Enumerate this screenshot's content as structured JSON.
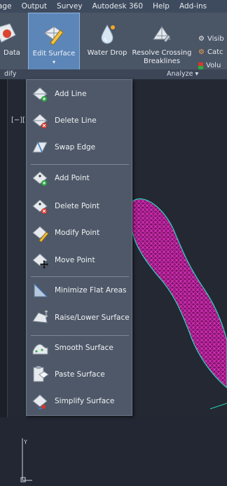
{
  "menubar": {
    "items": [
      "age",
      "Output",
      "Survey",
      "Autodesk 360",
      "Help",
      "Add-ins"
    ]
  },
  "ribbon": {
    "data_label": "Data",
    "edit_surface_label": "Edit Surface",
    "water_drop_label": "Water Drop",
    "resolve_line1": "Resolve Crossing",
    "resolve_line2": "Breaklines",
    "small": [
      "Visib",
      "Catc",
      "Volu"
    ],
    "panel_left": "dify",
    "panel_analyze": "Analyze ▾"
  },
  "viewport": {
    "label": "[−]["
  },
  "dropdown": {
    "items": [
      {
        "label": "Add Line",
        "icon": "add-line-icon"
      },
      {
        "label": "Delete Line",
        "icon": "delete-line-icon"
      },
      {
        "label": "Swap Edge",
        "icon": "swap-edge-icon"
      },
      {
        "label": "Add Point",
        "icon": "add-point-icon"
      },
      {
        "label": "Delete Point",
        "icon": "delete-point-icon"
      },
      {
        "label": "Modify Point",
        "icon": "modify-point-icon"
      },
      {
        "label": "Move Point",
        "icon": "move-point-icon"
      },
      {
        "label": "Minimize Flat Areas",
        "icon": "minimize-flat-areas-icon"
      },
      {
        "label": "Raise/Lower Surface",
        "icon": "raise-lower-surface-icon"
      },
      {
        "label": "Smooth Surface",
        "icon": "smooth-surface-icon"
      },
      {
        "label": "Paste Surface",
        "icon": "paste-surface-icon"
      },
      {
        "label": "Simplify Surface",
        "icon": "simplify-surface-icon"
      }
    ]
  },
  "colors": {
    "surface_mesh": "#c0189a",
    "surface_edge": "#2ad6b8"
  }
}
